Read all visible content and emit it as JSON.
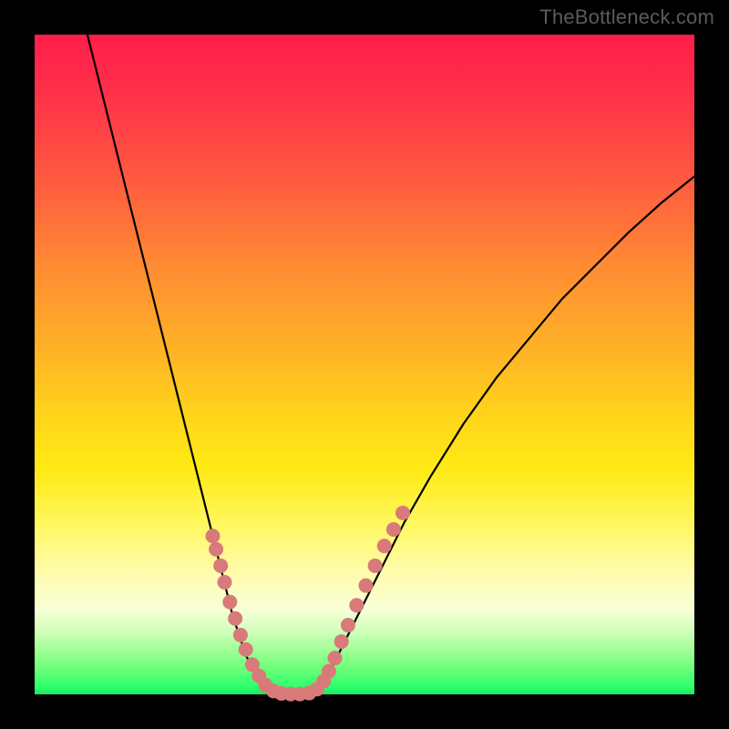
{
  "watermark": "TheBottleneck.com",
  "colors": {
    "gradient_top": "#ff1e4a",
    "gradient_mid": "#ffd51a",
    "gradient_bottom": "#19e561",
    "curve": "#000000",
    "markers": "#d97a7a",
    "frame": "#000000"
  },
  "chart_data": {
    "type": "line",
    "title": "",
    "xlabel": "",
    "ylabel": "",
    "xlim": [
      0,
      100
    ],
    "ylim": [
      0,
      100
    ],
    "series": [
      {
        "name": "left-branch",
        "x": [
          8,
          10,
          12,
          14,
          16,
          18,
          20,
          22,
          24,
          25,
          26,
          27,
          28,
          29,
          30,
          31,
          32,
          33,
          34,
          35,
          36
        ],
        "y": [
          100,
          92,
          84,
          76,
          68,
          60,
          52,
          44,
          36,
          32,
          28,
          24,
          20,
          16,
          12,
          9,
          6,
          4,
          2.5,
          1.2,
          0.5
        ]
      },
      {
        "name": "valley",
        "x": [
          36,
          37,
          38,
          39,
          40,
          41,
          42
        ],
        "y": [
          0.5,
          0.15,
          0.05,
          0.0,
          0.05,
          0.15,
          0.5
        ]
      },
      {
        "name": "right-branch",
        "x": [
          42,
          43,
          44,
          45,
          46,
          48,
          50,
          53,
          56,
          60,
          65,
          70,
          75,
          80,
          85,
          90,
          95,
          100
        ],
        "y": [
          0.5,
          1.2,
          2.5,
          4,
          6,
          10,
          14,
          20,
          26,
          33,
          41,
          48,
          54,
          60,
          65,
          70,
          74.5,
          78.5
        ]
      }
    ],
    "markers": [
      {
        "x": 27.0,
        "y": 24.0
      },
      {
        "x": 27.5,
        "y": 22.0
      },
      {
        "x": 28.2,
        "y": 19.5
      },
      {
        "x": 28.8,
        "y": 17.0
      },
      {
        "x": 29.6,
        "y": 14.0
      },
      {
        "x": 30.4,
        "y": 11.5
      },
      {
        "x": 31.2,
        "y": 9.0
      },
      {
        "x": 32.0,
        "y": 6.8
      },
      {
        "x": 33.0,
        "y": 4.5
      },
      {
        "x": 34.0,
        "y": 2.8
      },
      {
        "x": 35.0,
        "y": 1.4
      },
      {
        "x": 36.2,
        "y": 0.5
      },
      {
        "x": 37.4,
        "y": 0.15
      },
      {
        "x": 38.8,
        "y": 0.05
      },
      {
        "x": 40.2,
        "y": 0.05
      },
      {
        "x": 41.6,
        "y": 0.2
      },
      {
        "x": 42.8,
        "y": 0.8
      },
      {
        "x": 43.8,
        "y": 2.0
      },
      {
        "x": 44.6,
        "y": 3.5
      },
      {
        "x": 45.5,
        "y": 5.5
      },
      {
        "x": 46.5,
        "y": 8.0
      },
      {
        "x": 47.5,
        "y": 10.5
      },
      {
        "x": 48.8,
        "y": 13.5
      },
      {
        "x": 50.2,
        "y": 16.5
      },
      {
        "x": 51.6,
        "y": 19.5
      },
      {
        "x": 53.0,
        "y": 22.5
      },
      {
        "x": 54.4,
        "y": 25.0
      },
      {
        "x": 55.8,
        "y": 27.5
      }
    ],
    "marker_color": "#d97a7a",
    "marker_radius": 8
  }
}
